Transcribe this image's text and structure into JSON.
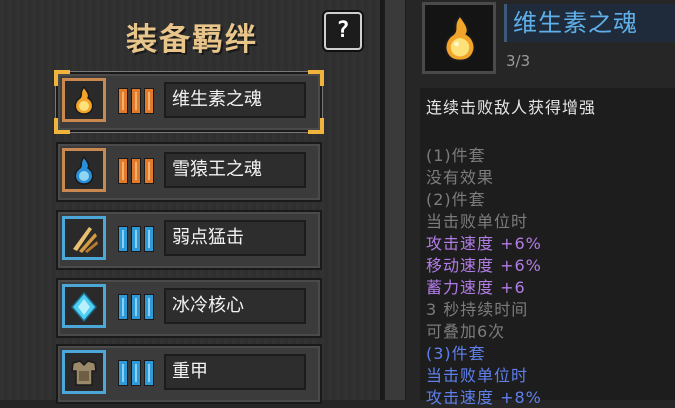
{
  "panel": {
    "title": "装备羁绊",
    "help_label": "?"
  },
  "items": [
    {
      "label": "维生素之魂",
      "tier_color": "#e27a2c",
      "frame": "orange",
      "icon": "golden-flame-orb-icon",
      "selected": true
    },
    {
      "label": "雪猿王之魂",
      "tier_color": "#e27a2c",
      "frame": "orange",
      "icon": "blue-flame-orb-icon",
      "selected": false
    },
    {
      "label": "弱点猛击",
      "tier_color": "#2f9ad8",
      "frame": "blue",
      "icon": "claw-slash-icon",
      "selected": false
    },
    {
      "label": "冰冷核心",
      "tier_color": "#2f9ad8",
      "frame": "blue",
      "icon": "ice-crystal-icon",
      "selected": false
    },
    {
      "label": "重甲",
      "tier_color": "#2f9ad8",
      "frame": "blue",
      "icon": "heavy-armor-icon",
      "selected": false
    }
  ],
  "detail": {
    "name": "维生素之魂",
    "count": "3/3",
    "icon": "golden-flame-orb-icon",
    "lines": [
      {
        "text": "连续击败敌人获得增强",
        "color": "white"
      },
      {
        "text": "",
        "color": "gray"
      },
      {
        "text": "(1)件套",
        "color": "gray"
      },
      {
        "text": "没有效果",
        "color": "gray"
      },
      {
        "text": "(2)件套",
        "color": "gray"
      },
      {
        "text": "当击败单位时",
        "color": "gray"
      },
      {
        "text": "攻击速度 +6%",
        "color": "purple"
      },
      {
        "text": "移动速度 +6%",
        "color": "purple"
      },
      {
        "text": "蓄力速度 +6",
        "color": "purple"
      },
      {
        "text": "3 秒持续时间",
        "color": "gray"
      },
      {
        "text": "可叠加6次",
        "color": "gray"
      },
      {
        "text": "(3)件套",
        "color": "blue"
      },
      {
        "text": "当击败单位时",
        "color": "blue"
      },
      {
        "text": "攻击速度 +8%",
        "color": "blue"
      }
    ]
  }
}
